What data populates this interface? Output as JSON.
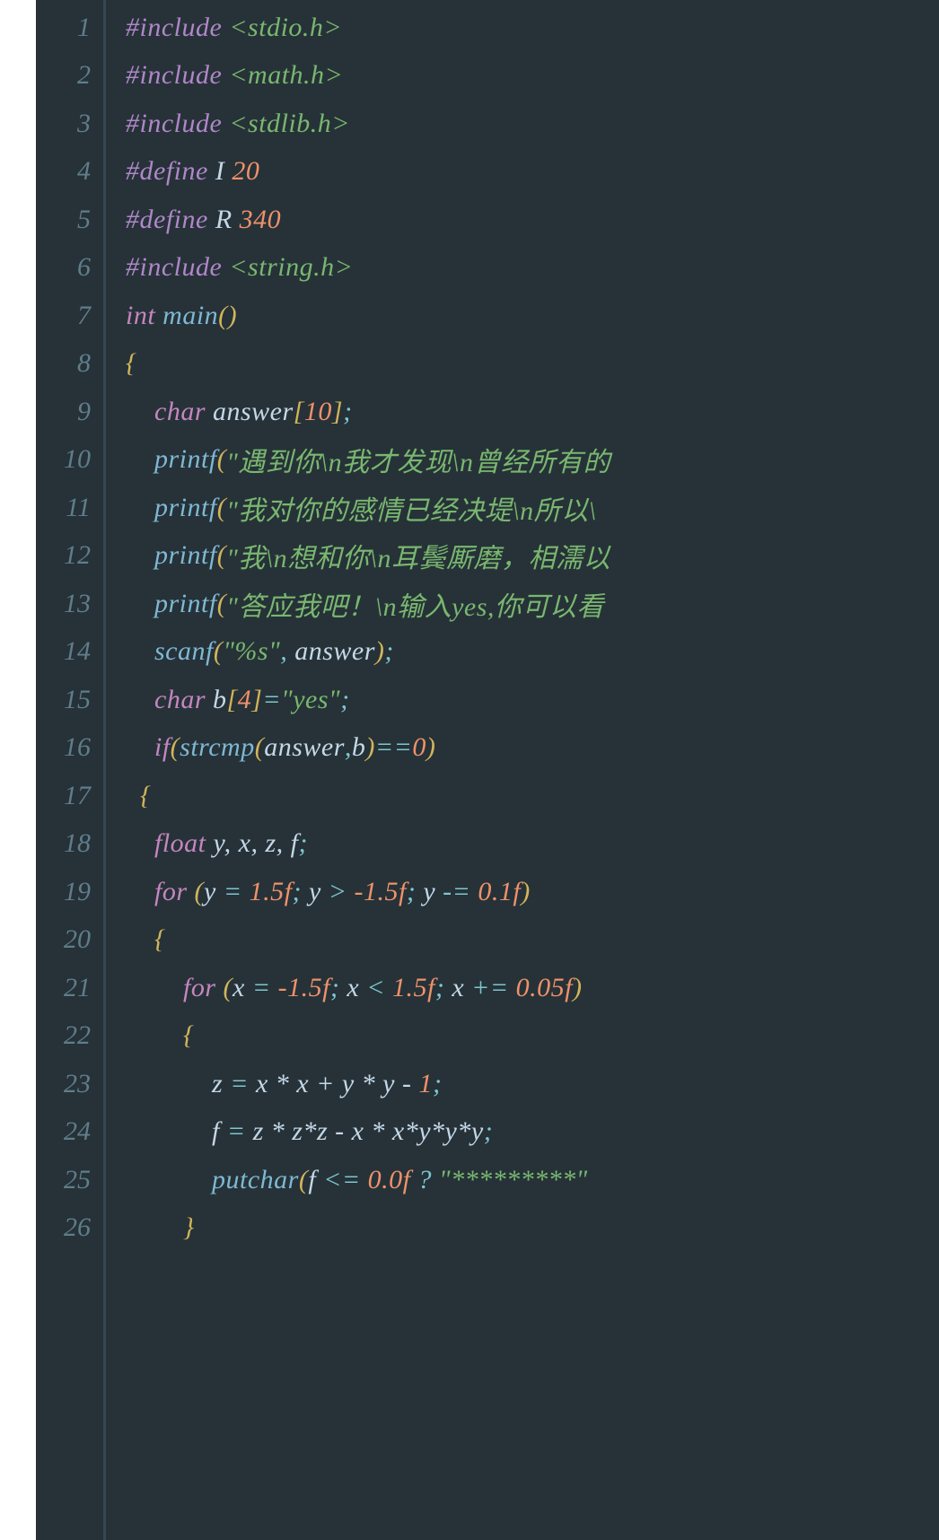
{
  "lineNumbers": [
    "1",
    "2",
    "3",
    "4",
    "5",
    "6",
    "7",
    "8",
    "9",
    "10",
    "11",
    "12",
    "13",
    "14",
    "15",
    "16",
    "17",
    "18",
    "19",
    "20",
    "21",
    "22",
    "23",
    "24",
    "25",
    "26"
  ],
  "code": {
    "l1": {
      "pre": "#include ",
      "inc": "<stdio.h>"
    },
    "l2": {
      "pre": "#include ",
      "inc": "<math.h>"
    },
    "l3": {
      "pre": "#include ",
      "inc": "<stdlib.h>"
    },
    "l4": {
      "def": "#define ",
      "name": "I ",
      "val": "20"
    },
    "l5": {
      "def": "#define ",
      "name": "R ",
      "val": "340"
    },
    "l6": {
      "pre": "#include ",
      "inc": "<string.h>"
    },
    "l7": {
      "type": "int ",
      "fn": "main",
      "paren": "()"
    },
    "l8": {
      "brace": "{"
    },
    "l9": {
      "indent": "    ",
      "type": "char ",
      "var": "answer",
      "br": "[",
      "n": "10",
      "br2": "]",
      "sc": ";"
    },
    "l10": {
      "indent": "    ",
      "fn": "printf",
      "p1": "(",
      "s": "\"遇到你\\n我才发现\\n曾经所有的",
      "tail": ""
    },
    "l11": {
      "indent": "    ",
      "fn": "printf",
      "p1": "(",
      "s": "\"我对你的感情已经决堤\\n所以\\",
      "tail": ""
    },
    "l12": {
      "indent": "    ",
      "fn": "printf",
      "p1": "(",
      "s": "\"我\\n想和你\\n耳鬓厮磨，相濡以",
      "tail": ""
    },
    "l13": {
      "indent": "    ",
      "fn": "printf",
      "p1": "(",
      "s": "\"答应我吧！\\n输入yes,你可以看",
      "tail": ""
    },
    "l14": {
      "indent": "    ",
      "fn": "scanf",
      "p1": "(",
      "s": "\"%s\"",
      "c": ", ",
      "var": "answer",
      "p2": ")",
      "sc": ";"
    },
    "l15": {
      "indent": "    ",
      "type": "char ",
      "var": "b",
      "br": "[",
      "n": "4",
      "br2": "]",
      "eq": "=",
      "s": "\"yes\"",
      "sc": ";"
    },
    "l16": {
      "indent": "    ",
      "kw": "if",
      "p1": "(",
      "fn": "strcmp",
      "p2": "(",
      "v1": "answer",
      "c": ",",
      "v2": "b",
      "p3": ")",
      "op": "==",
      "n": "0",
      "p4": ")"
    },
    "l17": {
      "indent": "  ",
      "brace": "{"
    },
    "l18": {
      "indent": "    ",
      "type": "float ",
      "vars": "y, x, z, f",
      "sc": ";"
    },
    "l19": {
      "indent": "    ",
      "kw": "for ",
      "p1": "(",
      "v": "y ",
      "eq": "= ",
      "n1": "1.5f",
      "sc1": "; ",
      "v2": "y ",
      "op": "> ",
      "n2": "-1.5f",
      "sc2": "; ",
      "v3": "y ",
      "op2": "-= ",
      "n3": "0.1f",
      "p2": ")"
    },
    "l20": {
      "indent": "    ",
      "brace": "{"
    },
    "l21": {
      "indent": "        ",
      "kw": "for ",
      "p1": "(",
      "v": "x ",
      "eq": "= ",
      "n1": "-1.5f",
      "sc1": "; ",
      "v2": "x ",
      "op": "< ",
      "n2": "1.5f",
      "sc2": "; ",
      "v3": "x ",
      "op2": "+= ",
      "n3": "0.05f",
      "p2": ")"
    },
    "l22": {
      "indent": "        ",
      "brace": "{"
    },
    "l23": {
      "indent": "            ",
      "expr_v": "z ",
      "eq": "= ",
      "rest": "x * x + y * y - ",
      "one": "1",
      "sc": ";"
    },
    "l24": {
      "indent": "            ",
      "expr_v": "f ",
      "eq": "= ",
      "rest": "z * z*z - x * x*y*y*y",
      "sc": ";"
    },
    "l25": {
      "indent": "            ",
      "fn": "putchar",
      "p1": "(",
      "v": "f ",
      "op": "<= ",
      "n": "0.0f ",
      "q": "? ",
      "s": "\"*********\""
    },
    "l26": {
      "indent": "        ",
      "brace": "}"
    }
  }
}
